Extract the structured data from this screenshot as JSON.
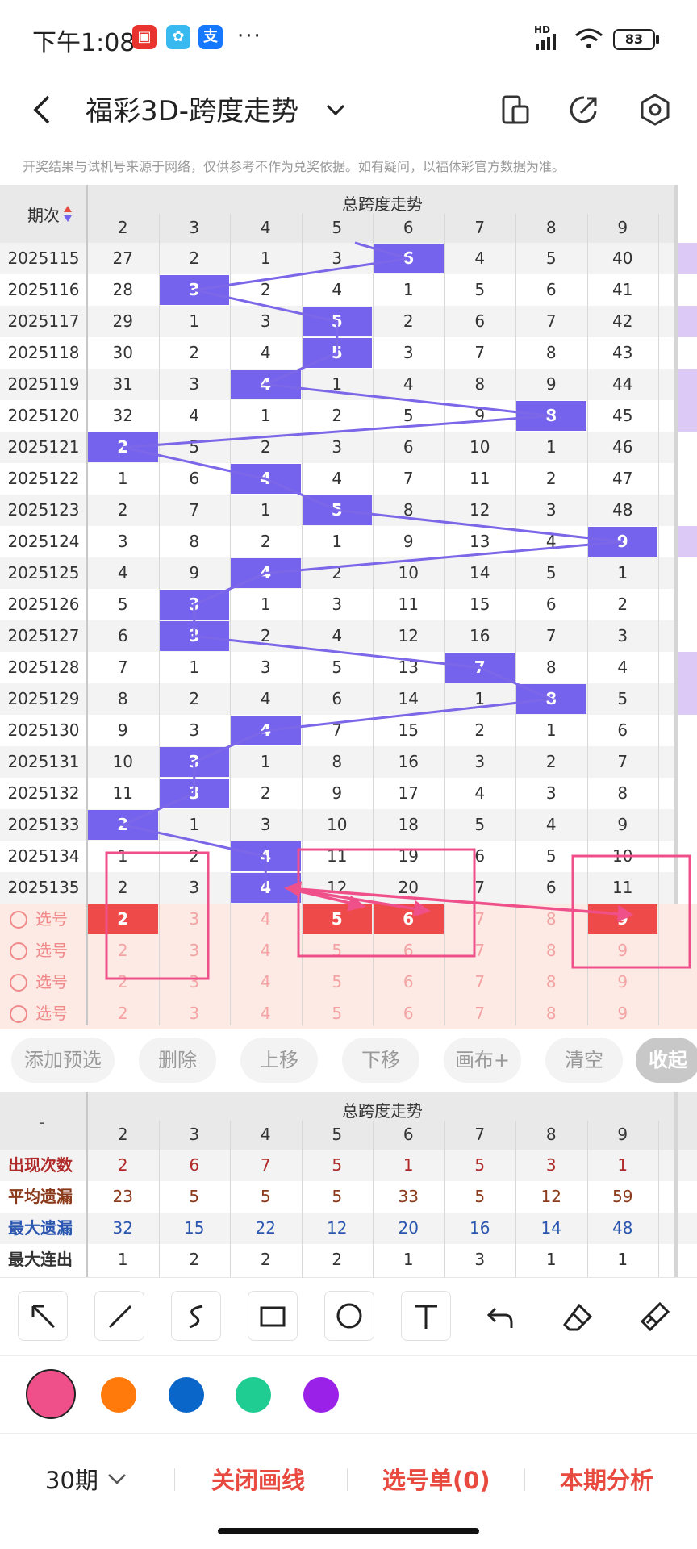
{
  "status_bar": {
    "time": "下午1:08",
    "apps": [
      {
        "icon": "red-packet-icon",
        "color": "#e8332f",
        "glyph": "▣"
      },
      {
        "icon": "gallery-icon",
        "color": "#3b82f6",
        "glyph": "✿"
      },
      {
        "icon": "alipay-icon",
        "color": "#1677ff",
        "glyph": "支"
      }
    ],
    "more": "···",
    "hd": "HD",
    "battery": "83"
  },
  "title_bar": {
    "title": "福彩3D-跨度走势",
    "notice": "开奖结果与试机号来源于网络，仅供参考不作为兑奖依据。如有疑问，以福体彩官方数据为准。"
  },
  "trend": {
    "group_title": "总跨度走势",
    "period_header": "期次",
    "columns": [
      "2",
      "3",
      "4",
      "5",
      "6",
      "7",
      "8",
      "9"
    ],
    "rows": [
      {
        "period": "2025115",
        "cells": [
          "27",
          "2",
          "1",
          "3",
          "6",
          "4",
          "5",
          "40"
        ],
        "hit": 4
      },
      {
        "period": "2025116",
        "cells": [
          "28",
          "3",
          "2",
          "4",
          "1",
          "5",
          "6",
          "41"
        ],
        "hit": 1
      },
      {
        "period": "2025117",
        "cells": [
          "29",
          "1",
          "3",
          "5",
          "2",
          "6",
          "7",
          "42"
        ],
        "hit": 3
      },
      {
        "period": "2025118",
        "cells": [
          "30",
          "2",
          "4",
          "5",
          "3",
          "7",
          "8",
          "43"
        ],
        "hit": 3
      },
      {
        "period": "2025119",
        "cells": [
          "31",
          "3",
          "4",
          "1",
          "4",
          "8",
          "9",
          "44"
        ],
        "hit": 2
      },
      {
        "period": "2025120",
        "cells": [
          "32",
          "4",
          "1",
          "2",
          "5",
          "9",
          "8",
          "45"
        ],
        "hit": 6
      },
      {
        "period": "2025121",
        "cells": [
          "2",
          "5",
          "2",
          "3",
          "6",
          "10",
          "1",
          "46"
        ],
        "hit": 0
      },
      {
        "period": "2025122",
        "cells": [
          "1",
          "6",
          "4",
          "4",
          "7",
          "11",
          "2",
          "47"
        ],
        "hit": 2
      },
      {
        "period": "2025123",
        "cells": [
          "2",
          "7",
          "1",
          "5",
          "8",
          "12",
          "3",
          "48"
        ],
        "hit": 3
      },
      {
        "period": "2025124",
        "cells": [
          "3",
          "8",
          "2",
          "1",
          "9",
          "13",
          "4",
          "9"
        ],
        "hit": 7
      },
      {
        "period": "2025125",
        "cells": [
          "4",
          "9",
          "4",
          "2",
          "10",
          "14",
          "5",
          "1"
        ],
        "hit": 2
      },
      {
        "period": "2025126",
        "cells": [
          "5",
          "3",
          "1",
          "3",
          "11",
          "15",
          "6",
          "2"
        ],
        "hit": 1
      },
      {
        "period": "2025127",
        "cells": [
          "6",
          "3",
          "2",
          "4",
          "12",
          "16",
          "7",
          "3"
        ],
        "hit": 1
      },
      {
        "period": "2025128",
        "cells": [
          "7",
          "1",
          "3",
          "5",
          "13",
          "7",
          "8",
          "4"
        ],
        "hit": 5
      },
      {
        "period": "2025129",
        "cells": [
          "8",
          "2",
          "4",
          "6",
          "14",
          "1",
          "8",
          "5"
        ],
        "hit": 6
      },
      {
        "period": "2025130",
        "cells": [
          "9",
          "3",
          "4",
          "7",
          "15",
          "2",
          "1",
          "6"
        ],
        "hit": 2
      },
      {
        "period": "2025131",
        "cells": [
          "10",
          "3",
          "1",
          "8",
          "16",
          "3",
          "2",
          "7"
        ],
        "hit": 1
      },
      {
        "period": "2025132",
        "cells": [
          "11",
          "3",
          "2",
          "9",
          "17",
          "4",
          "3",
          "8"
        ],
        "hit": 1
      },
      {
        "period": "2025133",
        "cells": [
          "2",
          "1",
          "3",
          "10",
          "18",
          "5",
          "4",
          "9"
        ],
        "hit": 0
      },
      {
        "period": "2025134",
        "cells": [
          "1",
          "2",
          "4",
          "11",
          "19",
          "6",
          "5",
          "10"
        ],
        "hit": 2
      },
      {
        "period": "2025135",
        "cells": [
          "2",
          "3",
          "4",
          "12",
          "20",
          "7",
          "6",
          "11"
        ],
        "hit": 2
      }
    ],
    "pick_rows": [
      {
        "label": "选号",
        "cells": [
          "2",
          "3",
          "4",
          "5",
          "6",
          "7",
          "8",
          "9"
        ],
        "selected": [
          0,
          3,
          4,
          7
        ]
      },
      {
        "label": "选号",
        "cells": [
          "2",
          "3",
          "4",
          "5",
          "6",
          "7",
          "8",
          "9"
        ],
        "selected": []
      },
      {
        "label": "选号",
        "cells": [
          "2",
          "3",
          "4",
          "5",
          "6",
          "7",
          "8",
          "9"
        ],
        "selected": []
      },
      {
        "label": "选号",
        "cells": [
          "2",
          "3",
          "4",
          "5",
          "6",
          "7",
          "8",
          "9"
        ],
        "selected": []
      }
    ]
  },
  "toolbar": {
    "add": "添加预选",
    "delete": "删除",
    "up": "上移",
    "down": "下移",
    "canvas": "画布+",
    "clear": "清空",
    "collapse": "收起"
  },
  "stats": {
    "corner": "-",
    "group_title": "总跨度走势",
    "columns": [
      "2",
      "3",
      "4",
      "5",
      "6",
      "7",
      "8",
      "9"
    ],
    "rows": [
      {
        "label": "出现次数",
        "color": "#b02a2a",
        "values": [
          "2",
          "6",
          "7",
          "5",
          "1",
          "5",
          "3",
          "1"
        ]
      },
      {
        "label": "平均遗漏",
        "color": "#8a3a1a",
        "values": [
          "23",
          "5",
          "5",
          "5",
          "33",
          "5",
          "12",
          "59"
        ]
      },
      {
        "label": "最大遗漏",
        "color": "#2a56b0",
        "values": [
          "32",
          "15",
          "22",
          "12",
          "20",
          "16",
          "14",
          "48"
        ]
      },
      {
        "label": "最大连出",
        "color": "#333333",
        "values": [
          "1",
          "2",
          "2",
          "2",
          "1",
          "3",
          "1",
          "1"
        ]
      }
    ]
  },
  "draw_tools": [
    "arrow-icon",
    "line-icon",
    "freehand-icon",
    "rectangle-icon",
    "circle-icon",
    "text-icon",
    "undo-icon",
    "eraser-icon",
    "clear-brush-icon"
  ],
  "colors": {
    "hit": "#7563ee",
    "line": "#7b67e8",
    "selected": "#ef4a4a",
    "annotation": "#f0508a",
    "swatches": [
      "#f0508a",
      "#ff7a0a",
      "#0a66c8",
      "#1fcc92",
      "#9a22e8"
    ]
  },
  "bottom": {
    "periods": "30期",
    "close_lines": "关闭画线",
    "pick_list": "选号单(0)",
    "analysis": "本期分析"
  }
}
